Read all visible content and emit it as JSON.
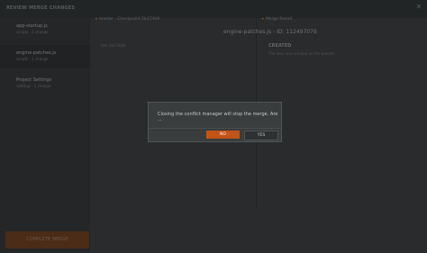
{
  "window": {
    "title": "REVIEW MERGE CHANGES",
    "close_icon": "close-icon"
  },
  "sidebar": {
    "files": [
      {
        "name": "app-startup.js",
        "meta": "scripts · 1 change"
      },
      {
        "name": "engine-patches.js",
        "meta": "scripts · 1 change"
      },
      {
        "name": "Project Settings",
        "meta": "settings · 1 change"
      }
    ],
    "complete_label": "COMPLETE MERGE"
  },
  "header": {
    "left_label": "master - Checkpoint 1b174b8",
    "right_label": "Merge Result",
    "file_title": "engine-patches.js - ID: 112497079"
  },
  "panels": {
    "left_ref": "Ref: 1b174b8",
    "right_title": "CREATED",
    "right_message": "The item was created on the branch"
  },
  "dialog": {
    "message": "Closing the conflict manager will stop the merge. Are ...",
    "no_label": "NO",
    "yes_label": "YES"
  }
}
